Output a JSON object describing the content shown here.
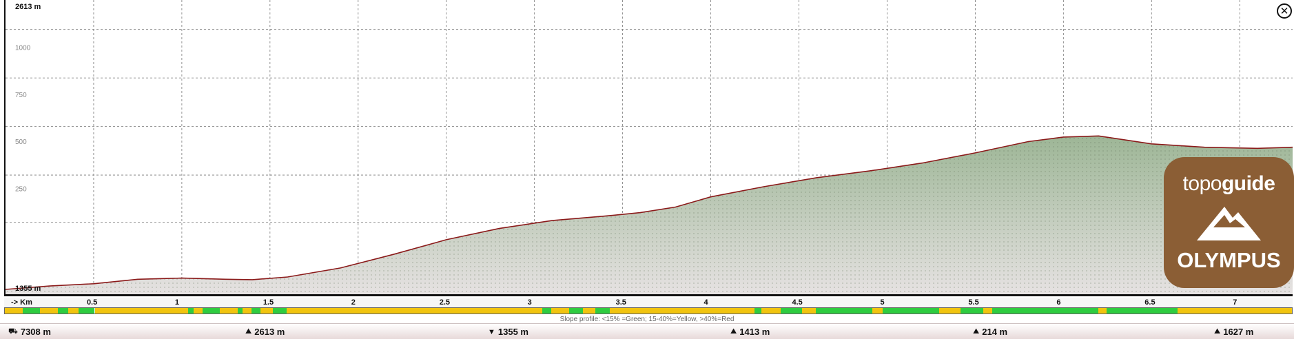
{
  "chart_data": {
    "type": "area",
    "ylabel_max": "2613 m",
    "ylabel_min": "1355 m",
    "y_ticks": [
      "1000",
      "750",
      "500",
      "250"
    ],
    "x_ticks": [
      "0.5",
      "1",
      "1.5",
      "2",
      "2.5",
      "3",
      "3.5",
      "4",
      "4.5",
      "5",
      "5.5",
      "6",
      "6.5",
      "7"
    ],
    "x_axis_label": "-> Km",
    "xlim": [
      0,
      7.3
    ],
    "ylim": [
      1355,
      2613
    ],
    "x": [
      0,
      0.25,
      0.5,
      0.75,
      1.0,
      1.25,
      1.4,
      1.6,
      1.9,
      2.2,
      2.5,
      2.8,
      3.1,
      3.4,
      3.6,
      3.8,
      4.0,
      4.3,
      4.6,
      4.9,
      5.2,
      5.5,
      5.8,
      6.0,
      6.2,
      6.5,
      6.8,
      7.1,
      7.3
    ],
    "y": [
      1355,
      1370,
      1380,
      1400,
      1405,
      1400,
      1398,
      1410,
      1450,
      1510,
      1575,
      1625,
      1660,
      1680,
      1695,
      1720,
      1765,
      1810,
      1850,
      1880,
      1915,
      1960,
      2010,
      2030,
      2035,
      2000,
      1985,
      1980,
      1985
    ],
    "slope_legend": "Slope profile: <15% =Green; 15-40%=Yellow, >40%=Red",
    "slope_segments": [
      {
        "from": 0.0,
        "to": 0.1,
        "c": "#f1c40f"
      },
      {
        "from": 0.1,
        "to": 0.2,
        "c": "#2ecc40"
      },
      {
        "from": 0.2,
        "to": 0.3,
        "c": "#f1c40f"
      },
      {
        "from": 0.3,
        "to": 0.36,
        "c": "#2ecc40"
      },
      {
        "from": 0.36,
        "to": 0.42,
        "c": "#f1c40f"
      },
      {
        "from": 0.42,
        "to": 0.51,
        "c": "#2ecc40"
      },
      {
        "from": 0.51,
        "to": 1.04,
        "c": "#f1c40f"
      },
      {
        "from": 1.04,
        "to": 1.07,
        "c": "#2ecc40"
      },
      {
        "from": 1.07,
        "to": 1.12,
        "c": "#f1c40f"
      },
      {
        "from": 1.12,
        "to": 1.22,
        "c": "#2ecc40"
      },
      {
        "from": 1.22,
        "to": 1.32,
        "c": "#f1c40f"
      },
      {
        "from": 1.32,
        "to": 1.35,
        "c": "#2ecc40"
      },
      {
        "from": 1.35,
        "to": 1.4,
        "c": "#f1c40f"
      },
      {
        "from": 1.4,
        "to": 1.45,
        "c": "#2ecc40"
      },
      {
        "from": 1.45,
        "to": 1.52,
        "c": "#f1c40f"
      },
      {
        "from": 1.52,
        "to": 1.6,
        "c": "#2ecc40"
      },
      {
        "from": 1.6,
        "to": 3.05,
        "c": "#f1c40f"
      },
      {
        "from": 3.05,
        "to": 3.1,
        "c": "#2ecc40"
      },
      {
        "from": 3.1,
        "to": 3.2,
        "c": "#f1c40f"
      },
      {
        "from": 3.2,
        "to": 3.28,
        "c": "#2ecc40"
      },
      {
        "from": 3.28,
        "to": 3.35,
        "c": "#f1c40f"
      },
      {
        "from": 3.35,
        "to": 3.43,
        "c": "#2ecc40"
      },
      {
        "from": 3.43,
        "to": 4.25,
        "c": "#f1c40f"
      },
      {
        "from": 4.25,
        "to": 4.29,
        "c": "#2ecc40"
      },
      {
        "from": 4.29,
        "to": 4.4,
        "c": "#f1c40f"
      },
      {
        "from": 4.4,
        "to": 4.52,
        "c": "#2ecc40"
      },
      {
        "from": 4.52,
        "to": 4.6,
        "c": "#f1c40f"
      },
      {
        "from": 4.6,
        "to": 4.92,
        "c": "#2ecc40"
      },
      {
        "from": 4.92,
        "to": 4.98,
        "c": "#f1c40f"
      },
      {
        "from": 4.98,
        "to": 5.3,
        "c": "#2ecc40"
      },
      {
        "from": 5.3,
        "to": 5.42,
        "c": "#f1c40f"
      },
      {
        "from": 5.42,
        "to": 5.55,
        "c": "#2ecc40"
      },
      {
        "from": 5.55,
        "to": 5.6,
        "c": "#f1c40f"
      },
      {
        "from": 5.6,
        "to": 6.2,
        "c": "#2ecc40"
      },
      {
        "from": 6.2,
        "to": 6.25,
        "c": "#f1c40f"
      },
      {
        "from": 6.25,
        "to": 6.65,
        "c": "#2ecc40"
      },
      {
        "from": 6.65,
        "to": 7.3,
        "c": "#f1c40f"
      }
    ],
    "colors": {
      "fill_top": "#9db696",
      "fill_bottom": "#e8e4e4",
      "line": "#8b1a1a"
    }
  },
  "logo": {
    "brand_light": "topo",
    "brand_bold": "guide",
    "sub": "OLYMPUS"
  },
  "close_icon": "close-icon",
  "stats": [
    {
      "icon": "distance-icon",
      "glyph": "⛟",
      "value": "7308 m"
    },
    {
      "icon": "max-elevation-icon",
      "glyph": "⛰",
      "value": "2613 m"
    },
    {
      "icon": "min-elevation-icon",
      "glyph": "▼",
      "value": "1355 m"
    },
    {
      "icon": "ascent-icon",
      "glyph": "⛰",
      "value": "1413 m"
    },
    {
      "icon": "descent-icon",
      "glyph": "⛰",
      "value": "214 m"
    },
    {
      "icon": "elevation-difference-icon",
      "glyph": "⛰",
      "value": "1627 m"
    }
  ]
}
